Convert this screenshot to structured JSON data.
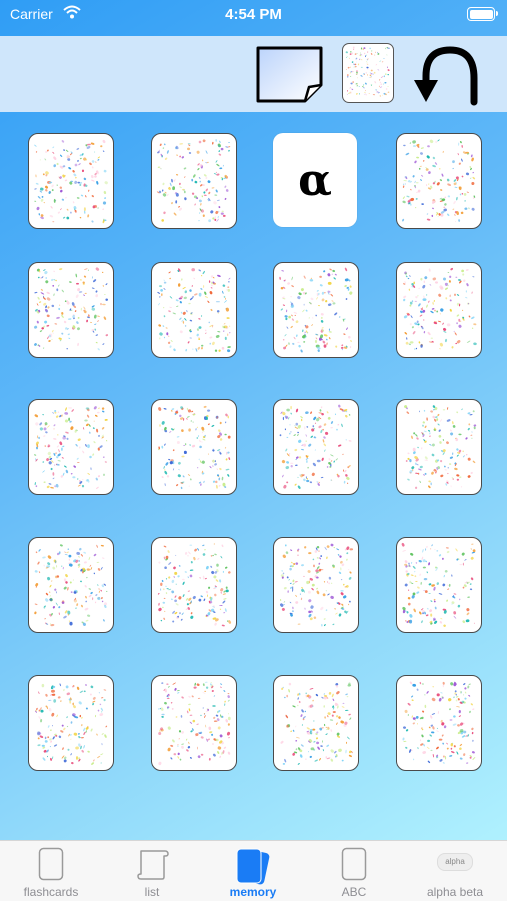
{
  "status_bar": {
    "carrier": "Carrier",
    "time": "4:54 PM"
  },
  "toolbar": {
    "buttons": [
      {
        "icon": "note-icon"
      },
      {
        "icon": "card-back-icon"
      },
      {
        "icon": "flip-arrow-icon"
      }
    ]
  },
  "memory_grid": {
    "columns": 4,
    "rows": 5,
    "revealed": {
      "index": 2,
      "symbol": "α"
    }
  },
  "tabbar": {
    "tabs": [
      {
        "label": "flashcards",
        "active": false
      },
      {
        "label": "list",
        "active": false
      },
      {
        "label": "memory",
        "active": true
      },
      {
        "label": "ABC",
        "active": false
      },
      {
        "label": "alpha beta",
        "active": false,
        "icon_text": "alpha"
      }
    ]
  },
  "colors": {
    "accent": "#1a7cf5",
    "toolbar": "#cfe6fb",
    "tab_inactive": "#8e8e93"
  }
}
